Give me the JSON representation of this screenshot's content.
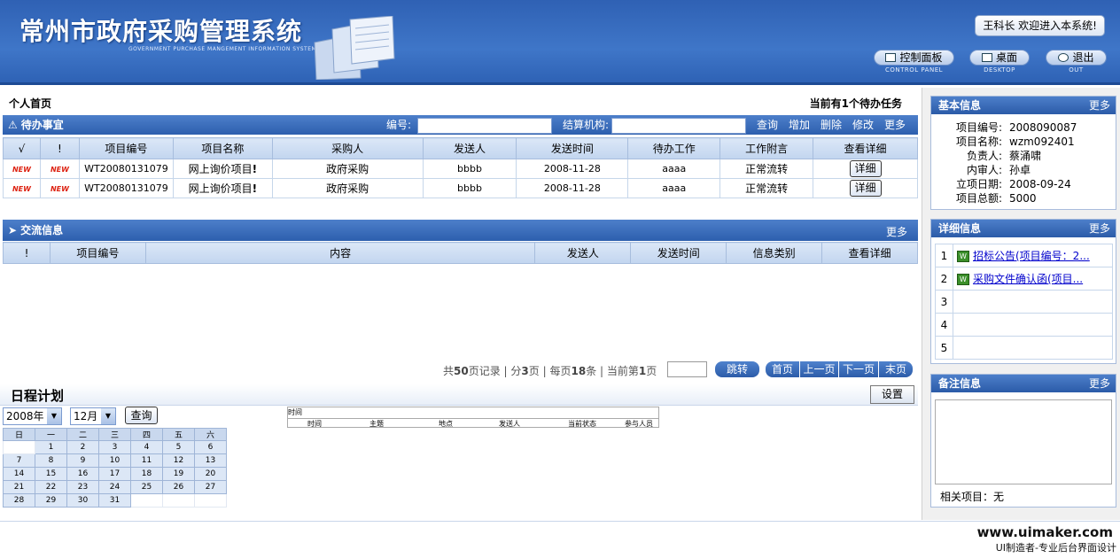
{
  "header": {
    "title": "常州市政府采购管理系统",
    "subtitle": "GOVERNMENT PURCHASE MANGEMENT INFORMATION SYSTEM",
    "welcome": "王科长 欢迎进入本系统!",
    "buttons": [
      {
        "label": "控制面板",
        "caption": "CONTROL PANEL",
        "icon": "control-panel-icon"
      },
      {
        "label": "桌面",
        "caption": "DESKTOP",
        "icon": "desktop-icon"
      },
      {
        "label": "退出",
        "caption": "OUT",
        "icon": "logout-icon"
      }
    ]
  },
  "main": {
    "breadcrumb": "个人首页",
    "task_count": "当前有1个待办任务",
    "todo": {
      "title": "待办事宜",
      "number_label": "编号:",
      "org_label": "结算机构:",
      "actions": [
        "查询",
        "增加",
        "删除",
        "修改",
        "更多"
      ],
      "columns": [
        "√",
        "!",
        "项目编号",
        "项目名称",
        "采购人",
        "发送人",
        "发送时间",
        "待办工作",
        "工作附言",
        "查看详细"
      ],
      "rows": [
        {
          "c1": "NEW",
          "c2": "NEW",
          "code": "WT20080131079",
          "name": "网上询价项目",
          "buyer": "政府采购",
          "sender": "bbbb",
          "time": "2008-11-28",
          "work": "aaaa",
          "note": "正常流转",
          "detail": "详细"
        },
        {
          "c1": "NEW",
          "c2": "NEW",
          "code": "WT20080131079",
          "name": "网上询价项目",
          "buyer": "政府采购",
          "sender": "bbbb",
          "time": "2008-11-28",
          "work": "aaaa",
          "note": "正常流转",
          "detail": "详细"
        }
      ]
    },
    "exchange": {
      "title": "交流信息",
      "more": "更多",
      "columns": [
        "!",
        "项目编号",
        "内容",
        "发送人",
        "发送时间",
        "信息类别",
        "查看详细"
      ]
    },
    "pager": {
      "total_pages": "50",
      "pages": "3",
      "per_page": "18",
      "current": "1",
      "text_total_pre": "共",
      "text_total_post": "页记录",
      "text_pages_pre": "分",
      "text_pages_post": "页",
      "text_per_pre": "每页",
      "text_per_post": "条",
      "text_cur_pre": "当前第",
      "text_cur_post": "页",
      "go": "跳转",
      "first": "首页",
      "prev": "上一页",
      "next": "下一页",
      "last": "末页"
    },
    "schedule": {
      "title": "日程计划",
      "settings": "设置",
      "year": "2008年",
      "month": "12月",
      "query": "查询",
      "weekdays": [
        "日",
        "一",
        "二",
        "三",
        "四",
        "五",
        "六"
      ],
      "weeks": [
        [
          "",
          "1",
          "2",
          "3",
          "4",
          "5",
          "6"
        ],
        [
          "7",
          "8",
          "9",
          "10",
          "11",
          "12",
          "13"
        ],
        [
          "14",
          "15",
          "16",
          "17",
          "18",
          "19",
          "20"
        ],
        [
          "21",
          "22",
          "23",
          "24",
          "25",
          "26",
          "27"
        ],
        [
          "28",
          "29",
          "30",
          "31",
          "",
          "",
          ""
        ]
      ],
      "list_label": "时间",
      "list_columns": [
        "时间",
        "主题",
        "地点",
        "发送人",
        "当前状态",
        "参与人员"
      ]
    }
  },
  "right": {
    "basic": {
      "title": "基本信息",
      "more": "更多",
      "rows": [
        {
          "k": "项目编号:",
          "v": "2008090087"
        },
        {
          "k": "项目名称:",
          "v": "wzm092401"
        },
        {
          "k": "负责人:",
          "v": "蔡涌啸"
        },
        {
          "k": "内审人:",
          "v": "孙卓"
        },
        {
          "k": "立项日期:",
          "v": "2008-09-24"
        },
        {
          "k": "项目总额:",
          "v": "5000"
        }
      ]
    },
    "detail": {
      "title": "详细信息",
      "more": "更多",
      "rows": [
        {
          "n": "1",
          "text": "招标公告(项目编号：2..."
        },
        {
          "n": "2",
          "text": "采购文件确认函(项目..."
        },
        {
          "n": "3",
          "text": ""
        },
        {
          "n": "4",
          "text": ""
        },
        {
          "n": "5",
          "text": ""
        }
      ]
    },
    "notes": {
      "title": "备注信息",
      "more": "更多",
      "related": "相关项目：无"
    }
  },
  "footer": {
    "site": "www.uimaker.com",
    "slogan": "UI制造者-专业后台界面设计"
  }
}
